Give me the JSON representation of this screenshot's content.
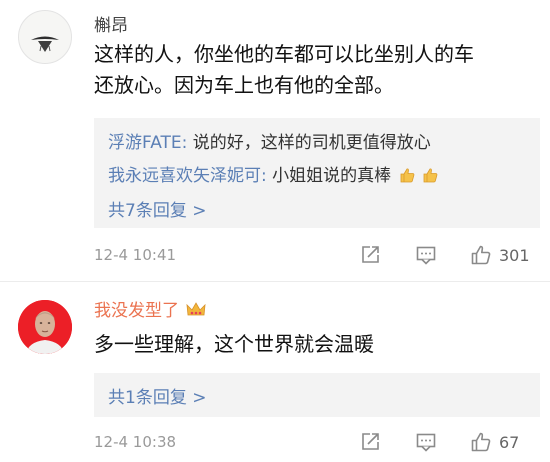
{
  "comments": [
    {
      "username": "槲昂",
      "body_lines": [
        "这样的人，你坐他的车都可以比坐别人的车",
        "还放心。因为车上也有他的全部。"
      ],
      "replies": [
        {
          "name": "浮游FATE:",
          "text": " 说的好，这样的司机更值得放心"
        },
        {
          "name": "我永远喜欢矢泽妮可:",
          "text": " 小姐姐说的真棒"
        }
      ],
      "more_replies": "共7条回复 >",
      "time": "12-4 10:41",
      "likes": "301"
    },
    {
      "username": "我没发型了",
      "body_lines": [
        "多一些理解，这个世界就会温暖"
      ],
      "more_replies": "共1条回复 >",
      "time": "12-4 10:38",
      "likes": "67"
    }
  ],
  "icons": {
    "share": "share-icon",
    "comment": "comment-icon",
    "like": "like-thumb-icon",
    "emoji_thumb": "thumbs-up-emoji",
    "emoji_crown": "crown-emoji"
  },
  "colors": {
    "link_blue": "#5b7fb5",
    "username_orange": "#eb7350",
    "reply_bg": "#f3f3f3",
    "meta_gray": "#9a9a9a"
  }
}
